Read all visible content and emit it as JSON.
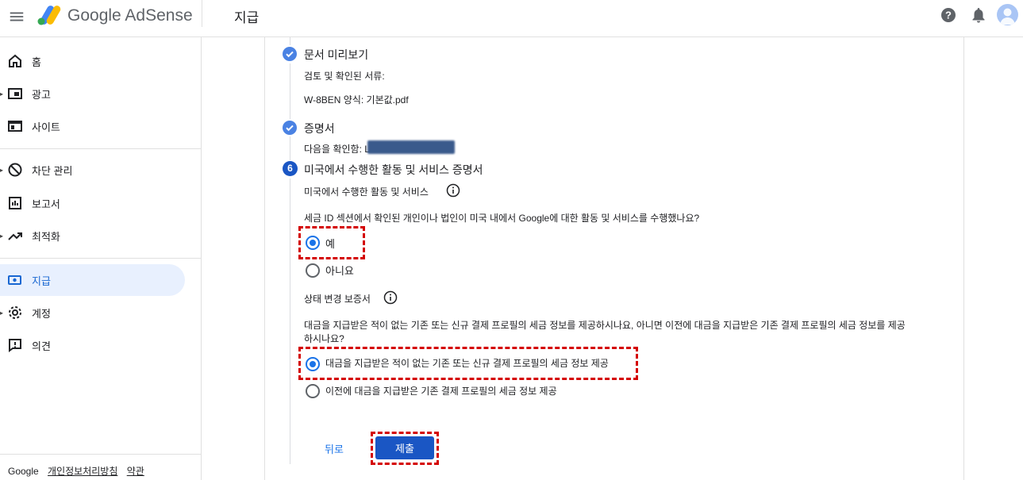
{
  "header": {
    "brand": "Google AdSense",
    "page_title": "지급"
  },
  "sidebar": {
    "items": [
      {
        "label": "홈"
      },
      {
        "label": "광고"
      },
      {
        "label": "사이트"
      },
      {
        "label": "차단 관리"
      },
      {
        "label": "보고서"
      },
      {
        "label": "최적화"
      },
      {
        "label": "지급"
      },
      {
        "label": "계정"
      },
      {
        "label": "의견"
      }
    ],
    "footer": {
      "google": "Google",
      "privacy": "개인정보처리방침",
      "terms": "약관"
    }
  },
  "steps": {
    "preview": {
      "title": "문서 미리보기",
      "reviewed_label": "검토 및 확인된 서류:",
      "doc_name": "W-8BEN 양식: 기본값.pdf"
    },
    "certification": {
      "title": "증명서",
      "confirm_label": "다음을 확인함: L"
    },
    "us_activities": {
      "number": "6",
      "title": "미국에서 수행한 활동 및 서비스 증명서",
      "sub_label": "미국에서 수행한 활동 및 서비스",
      "question": "세금 ID 섹션에서 확인된 개인이나 법인이 미국 내에서 Google에 대한 활동 및 서비스를 수행했나요?",
      "options": [
        "예",
        "아니요"
      ],
      "selected": "예",
      "status_label": "상태 변경 보증서",
      "status_question_line1": "대금을 지급받은 적이 없는 기존 또는 신규 결제 프로필의 세금 정보를 제공하시나요, 아니면 이전에 대금을 지급받은 기존 결제 프로필의 세금 정보를 제공",
      "status_question_line2": "하시나요?",
      "status_options": [
        "대금을 지급받은 적이 없는 기존 또는 신규 결제 프로필의 세금 정보 제공",
        "이전에 대금을 지급받은 기존 결제 프로필의 세금 정보 제공"
      ],
      "status_selected": "대금을 지급받은 적이 없는 기존 또는 신규 결제 프로필의 세금 정보 제공"
    }
  },
  "actions": {
    "back": "뒤로",
    "submit": "제출"
  },
  "colors": {
    "accent": "#1a73e8",
    "highlight": "#d40000"
  }
}
